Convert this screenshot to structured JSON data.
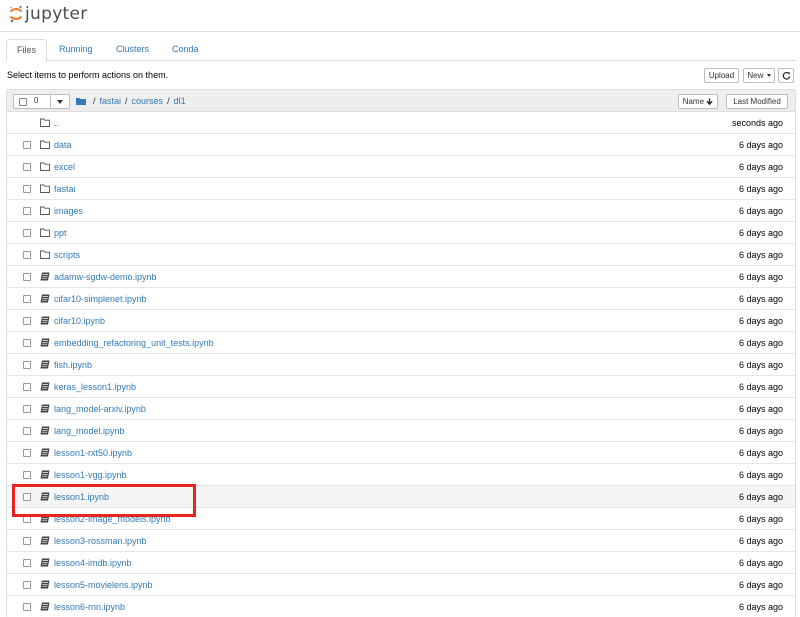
{
  "app": {
    "logo_text": "jupyter"
  },
  "tabs": [
    {
      "label": "Files",
      "active": true
    },
    {
      "label": "Running",
      "active": false
    },
    {
      "label": "Clusters",
      "active": false
    },
    {
      "label": "Conda",
      "active": false
    }
  ],
  "toolbar": {
    "instructions": "Select items to perform actions on them.",
    "upload_label": "Upload",
    "new_label": "New",
    "refresh_icon": "refresh-icon"
  },
  "list_header": {
    "selected_count": "0",
    "breadcrumb": [
      "fastai",
      "courses",
      "dl1"
    ],
    "sort_name_label": "Name",
    "sort_modified_label": "Last Modified"
  },
  "items": [
    {
      "name": "..",
      "type": "folder",
      "modified": "seconds ago",
      "checkbox": false
    },
    {
      "name": "data",
      "type": "folder",
      "modified": "6 days ago",
      "checkbox": true
    },
    {
      "name": "excel",
      "type": "folder",
      "modified": "6 days ago",
      "checkbox": true
    },
    {
      "name": "fastai",
      "type": "folder",
      "modified": "6 days ago",
      "checkbox": true
    },
    {
      "name": "images",
      "type": "folder",
      "modified": "6 days ago",
      "checkbox": true
    },
    {
      "name": "ppt",
      "type": "folder",
      "modified": "6 days ago",
      "checkbox": true
    },
    {
      "name": "scripts",
      "type": "folder",
      "modified": "6 days ago",
      "checkbox": true
    },
    {
      "name": "adamw-sgdw-demo.ipynb",
      "type": "notebook",
      "modified": "6 days ago",
      "checkbox": true
    },
    {
      "name": "cifar10-simplenet.ipynb",
      "type": "notebook",
      "modified": "6 days ago",
      "checkbox": true
    },
    {
      "name": "cifar10.ipynb",
      "type": "notebook",
      "modified": "6 days ago",
      "checkbox": true
    },
    {
      "name": "embedding_refactoring_unit_tests.ipynb",
      "type": "notebook",
      "modified": "6 days ago",
      "checkbox": true
    },
    {
      "name": "fish.ipynb",
      "type": "notebook",
      "modified": "6 days ago",
      "checkbox": true
    },
    {
      "name": "keras_lesson1.ipynb",
      "type": "notebook",
      "modified": "6 days ago",
      "checkbox": true
    },
    {
      "name": "lang_model-arxiv.ipynb",
      "type": "notebook",
      "modified": "6 days ago",
      "checkbox": true
    },
    {
      "name": "lang_model.ipynb",
      "type": "notebook",
      "modified": "6 days ago",
      "checkbox": true
    },
    {
      "name": "lesson1-rxt50.ipynb",
      "type": "notebook",
      "modified": "6 days ago",
      "checkbox": true
    },
    {
      "name": "lesson1-vgg.ipynb",
      "type": "notebook",
      "modified": "6 days ago",
      "checkbox": true
    },
    {
      "name": "lesson1.ipynb",
      "type": "notebook",
      "modified": "6 days ago",
      "checkbox": true,
      "highlighted": true
    },
    {
      "name": "lesson2-image_models.ipynb",
      "type": "notebook",
      "modified": "6 days ago",
      "checkbox": true
    },
    {
      "name": "lesson3-rossman.ipynb",
      "type": "notebook",
      "modified": "6 days ago",
      "checkbox": true
    },
    {
      "name": "lesson4-imdb.ipynb",
      "type": "notebook",
      "modified": "6 days ago",
      "checkbox": true
    },
    {
      "name": "lesson5-movielens.ipynb",
      "type": "notebook",
      "modified": "6 days ago",
      "checkbox": true
    },
    {
      "name": "lesson6-rnn.ipynb",
      "type": "notebook",
      "modified": "6 days ago",
      "checkbox": true
    }
  ],
  "colors": {
    "link": "#337ab7",
    "highlight_box": "#e8241f",
    "logo_orange": "#f37726"
  }
}
